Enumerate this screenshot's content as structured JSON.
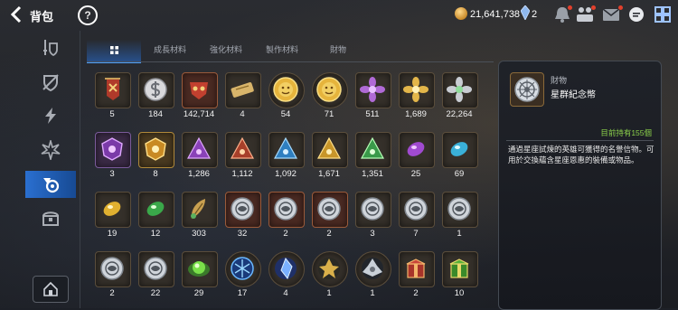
{
  "header": {
    "title": "背包",
    "help_label": "?",
    "gold": "21,641,738",
    "gems": "2"
  },
  "colors": {
    "accent": "#2a6fd0",
    "owned_text": "#8bd04b"
  },
  "sidebar": {
    "items": [
      {
        "icon": "sword-shield-icon"
      },
      {
        "icon": "broken-shield-icon"
      },
      {
        "icon": "lightning-icon"
      },
      {
        "icon": "burst-icon"
      },
      {
        "icon": "medal-coin-icon",
        "active": true
      },
      {
        "icon": "chest-icon"
      }
    ],
    "bottom_icon": "house-icon"
  },
  "tabs": [
    {
      "label": "",
      "icon": "grid-icon",
      "active": true
    },
    {
      "label": "成長材料"
    },
    {
      "label": "強化材料"
    },
    {
      "label": "製作材料"
    },
    {
      "label": "財物"
    }
  ],
  "grid_items": [
    {
      "qty": "5",
      "icon": "banner-icon",
      "frame": ""
    },
    {
      "qty": "184",
      "icon": "dollar-coin-icon",
      "frame": ""
    },
    {
      "qty": "142,714",
      "icon": "mask-icon",
      "frame": "red"
    },
    {
      "qty": "4",
      "icon": "ticket-icon",
      "frame": ""
    },
    {
      "qty": "54",
      "icon": "lion-coin-icon",
      "frame": "round"
    },
    {
      "qty": "71",
      "icon": "lion-coin-icon",
      "frame": "round"
    },
    {
      "qty": "511",
      "icon": "purple-flower-icon",
      "frame": ""
    },
    {
      "qty": "1,689",
      "icon": "gold-flower-icon",
      "frame": ""
    },
    {
      "qty": "22,264",
      "icon": "silver-flower-icon",
      "frame": ""
    },
    {
      "qty": "3",
      "icon": "purple-crest-icon",
      "frame": "purple"
    },
    {
      "qty": "8",
      "icon": "gold-crest-icon",
      "frame": "gold"
    },
    {
      "qty": "1,286",
      "icon": "purple-triangle-icon",
      "frame": ""
    },
    {
      "qty": "1,112",
      "icon": "red-triangle-icon",
      "frame": ""
    },
    {
      "qty": "1,092",
      "icon": "blue-triangle-icon",
      "frame": ""
    },
    {
      "qty": "1,671",
      "icon": "gold-triangle-icon",
      "frame": ""
    },
    {
      "qty": "1,351",
      "icon": "green-triangle-icon",
      "frame": ""
    },
    {
      "qty": "25",
      "icon": "purple-gem-icon",
      "frame": ""
    },
    {
      "qty": "69",
      "icon": "cyan-gem-icon",
      "frame": ""
    },
    {
      "qty": "19",
      "icon": "gold-gem-icon",
      "frame": ""
    },
    {
      "qty": "12",
      "icon": "green-gem-icon",
      "frame": ""
    },
    {
      "qty": "303",
      "icon": "feather-icon",
      "frame": ""
    },
    {
      "qty": "32",
      "icon": "zodiac-coin-icon",
      "frame": "red"
    },
    {
      "qty": "2",
      "icon": "zodiac-coin-icon",
      "frame": "red"
    },
    {
      "qty": "2",
      "icon": "zodiac-coin-icon",
      "frame": "red"
    },
    {
      "qty": "3",
      "icon": "zodiac-coin-icon",
      "frame": ""
    },
    {
      "qty": "7",
      "icon": "zodiac-coin-icon",
      "frame": ""
    },
    {
      "qty": "1",
      "icon": "zodiac-coin-icon",
      "frame": ""
    },
    {
      "qty": "2",
      "icon": "zodiac-coin-icon",
      "frame": ""
    },
    {
      "qty": "22",
      "icon": "zodiac-coin-icon",
      "frame": ""
    },
    {
      "qty": "29",
      "icon": "green-orb-icon",
      "frame": ""
    },
    {
      "qty": "17",
      "icon": "blue-rune-icon",
      "frame": "round"
    },
    {
      "qty": "4",
      "icon": "crystal-icon",
      "frame": "round"
    },
    {
      "qty": "1",
      "icon": "gold-emblem-icon",
      "frame": "round"
    },
    {
      "qty": "1",
      "icon": "silver-emblem-icon",
      "frame": "round"
    },
    {
      "qty": "2",
      "icon": "red-box-icon",
      "frame": ""
    },
    {
      "qty": "10",
      "icon": "green-box-icon",
      "frame": ""
    }
  ],
  "detail": {
    "category": "財物",
    "name": "星群紀念幣",
    "owned": "目前持有155個",
    "description": "通過星座試煉的英雄可獲得的名譽信物。可用於交換蘊含星座恩惠的裝備或物品。"
  }
}
